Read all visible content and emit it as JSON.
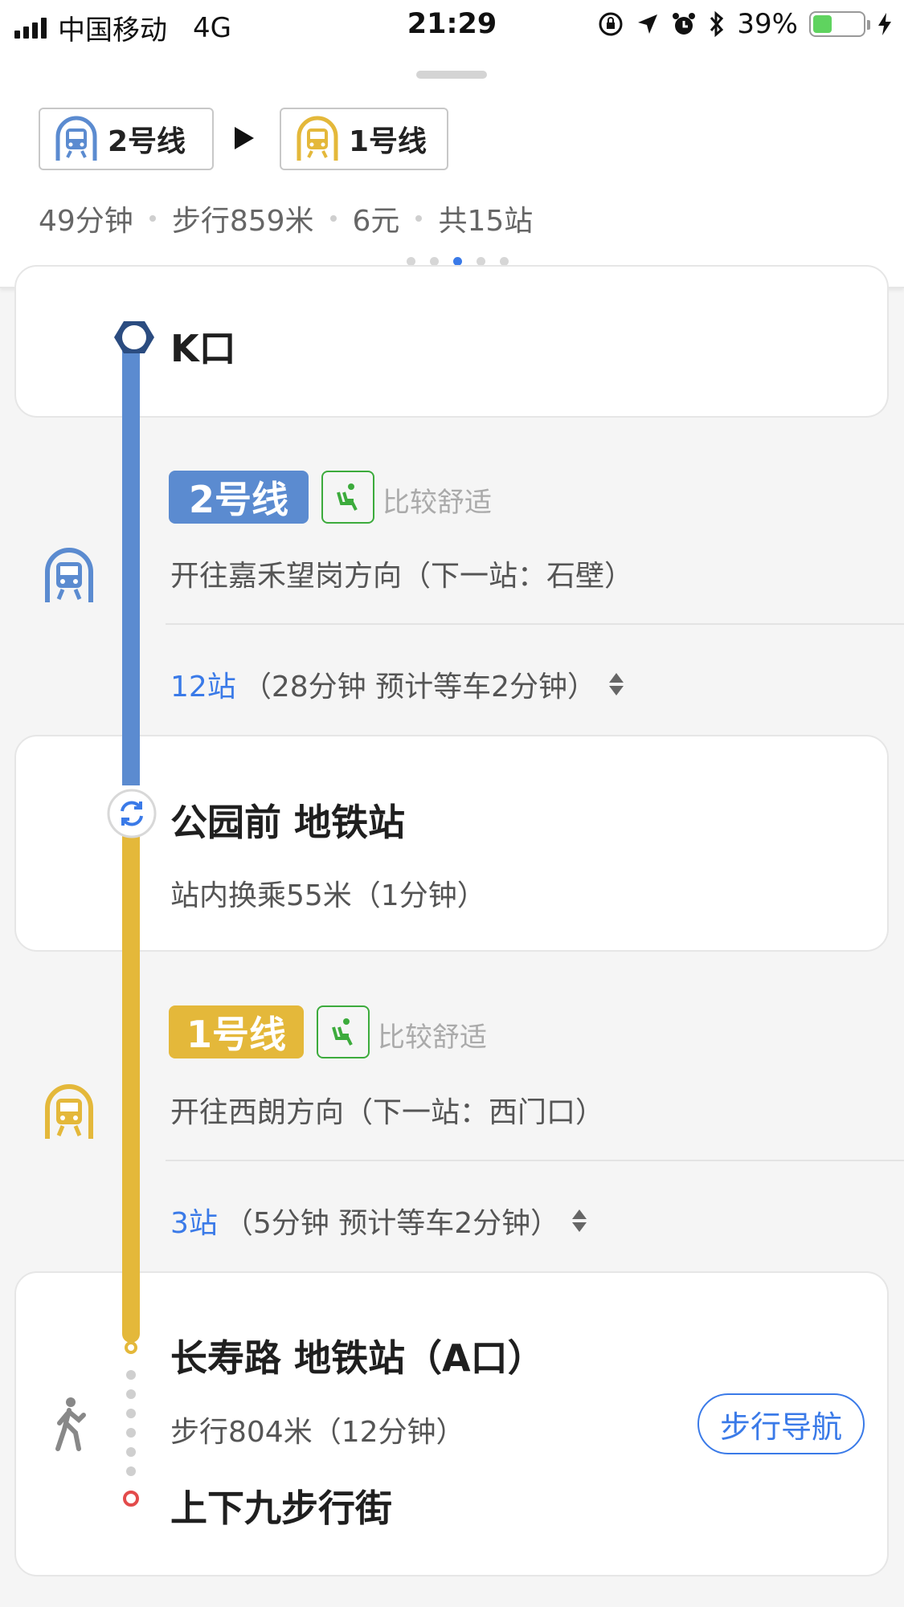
{
  "status_bar": {
    "carrier": "中国移动",
    "network": "4G",
    "time": "21:29",
    "battery": "39%",
    "battery_level": 0.39
  },
  "summary": {
    "route_chips": [
      {
        "label": "2号线",
        "color": "#5b8bd0"
      },
      {
        "label": "1号线",
        "color": "#e8b830"
      }
    ],
    "duration": "49分钟",
    "walk": "步行859米",
    "fare": "6元",
    "stations": "共15站",
    "page_count": 5,
    "active_page": 3
  },
  "route": {
    "start": {
      "label": "K口"
    },
    "segment1": {
      "line": "2号线",
      "line_color": "#5b8bd0",
      "comfort": "比较舒适",
      "direction": "开往嘉禾望岗方向（下一站：石壁）",
      "stop_count": "12站",
      "stop_detail": "（28分钟 预计等车2分钟）"
    },
    "transfer": {
      "station": "公园前 地铁站",
      "detail": "站内换乘55米（1分钟）"
    },
    "segment2": {
      "line": "1号线",
      "line_color": "#e4b83a",
      "comfort": "比较舒适",
      "direction": "开往西朗方向（下一站：西门口）",
      "stop_count": "3站",
      "stop_detail": "（5分钟 预计等车2分钟）"
    },
    "arrival": {
      "station": "长寿路 地铁站（A口）",
      "walk_detail": "步行804米（12分钟）",
      "nav_button": "步行导航",
      "destination": "上下九步行街"
    }
  },
  "colors": {
    "accent": "#3a7ae8",
    "comfort_green": "#3cab3c",
    "destination_red": "#e34b4b"
  }
}
